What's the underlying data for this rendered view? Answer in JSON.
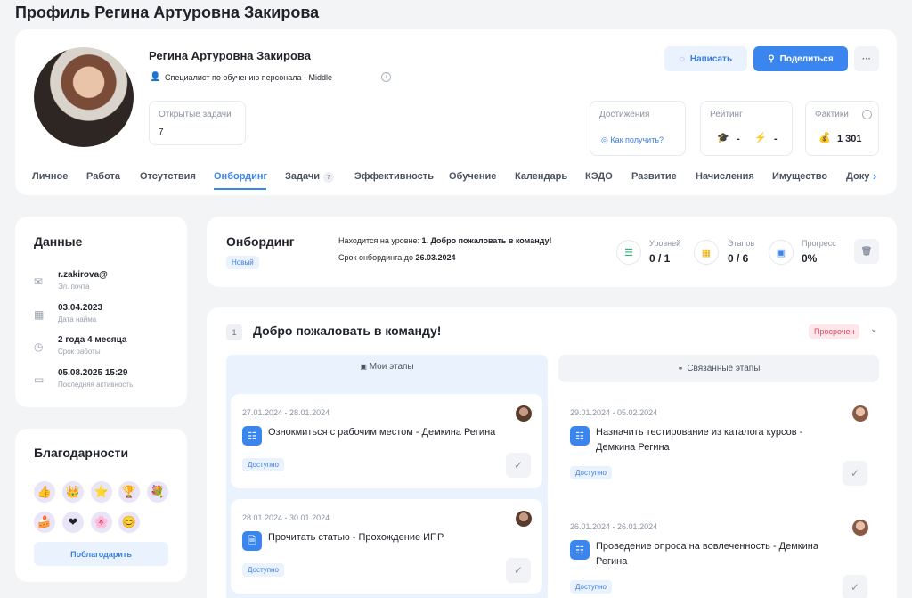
{
  "page": {
    "title": "Профиль Регина Артуровна Закирова"
  },
  "profile": {
    "name": "Регина Артуровна Закирова",
    "position": "Специалист по обучению персонала  - Middle",
    "open_tasks_label": "Открытые задачи",
    "open_tasks_value": "7"
  },
  "actions": {
    "write": "Написать",
    "share": "Поделиться",
    "more": "···"
  },
  "achievements": {
    "title": "Достижения",
    "link": "Как получить?"
  },
  "rating": {
    "title": "Рейтинг",
    "value1": "-",
    "value2": "-"
  },
  "facts": {
    "title": "Фактики",
    "value": "1 301"
  },
  "tabs": [
    {
      "label": "Личное"
    },
    {
      "label": "Работа"
    },
    {
      "label": "Отсутствия"
    },
    {
      "label": "Онбординг"
    },
    {
      "label": "Задачи",
      "count": "7"
    },
    {
      "label": "Эффективность"
    },
    {
      "label": "Обучение"
    },
    {
      "label": "Календарь"
    },
    {
      "label": "КЭДО"
    },
    {
      "label": "Развитие"
    },
    {
      "label": "Начисления"
    },
    {
      "label": "Имущество"
    },
    {
      "label": "Доку"
    }
  ],
  "data_panel": {
    "title": "Данные",
    "rows": [
      {
        "value": "r.zakirova@",
        "label": "Эл. почта"
      },
      {
        "value": "03.04.2023",
        "label": "Дата найма"
      },
      {
        "value": "2 года 4 месяца",
        "label": "Срок работы"
      },
      {
        "value": "05.08.2025 15:29",
        "label": "Последняя активность"
      }
    ]
  },
  "thanks": {
    "title": "Благодарности",
    "button": "Поблагодарить"
  },
  "onboarding": {
    "title": "Онбординг",
    "status": "Новый",
    "level_prefix": "Находится на уровне: ",
    "level": "1. Добро пожаловать в команду!",
    "deadline_prefix": "Срок онбординга до ",
    "deadline": "26.03.2024",
    "levels_label": "Уровней",
    "levels_value": "0 / 1",
    "stages_label": "Этапов",
    "stages_value": "0 / 6",
    "progress_label": "Прогресс",
    "progress_value": "0%"
  },
  "level_card": {
    "number": "1",
    "title": "Добро пожаловать в команду!",
    "overdue": "Просрочен",
    "my_stages_tab": "Мои этапы",
    "linked_stages_tab": "Связанные этапы"
  },
  "my_stages": [
    {
      "dates": "27.01.2024 - 28.01.2024",
      "title": "Ознокмиться с рабочим местом - Демкина Регина",
      "status": "Доступно"
    },
    {
      "dates": "28.01.2024 - 30.01.2024",
      "title": "Прочитать статью - Прохождение ИПР",
      "status": "Доступно"
    }
  ],
  "linked_stages": [
    {
      "dates": "29.01.2024 - 05.02.2024",
      "title_line1": "Назначить тестирование из каталога курсов -",
      "title_line2": "Демкина Регина",
      "status": "Доступно"
    },
    {
      "dates": "26.01.2024 - 26.01.2024",
      "title_line1": "Проведение опроса на вовлеченность - Демкина",
      "title_line2": "Регина",
      "status": "Доступно"
    }
  ],
  "colors": {
    "accent": "#3b86ee",
    "overdue_bg": "#fde7ea",
    "overdue_text": "#e0475e"
  }
}
